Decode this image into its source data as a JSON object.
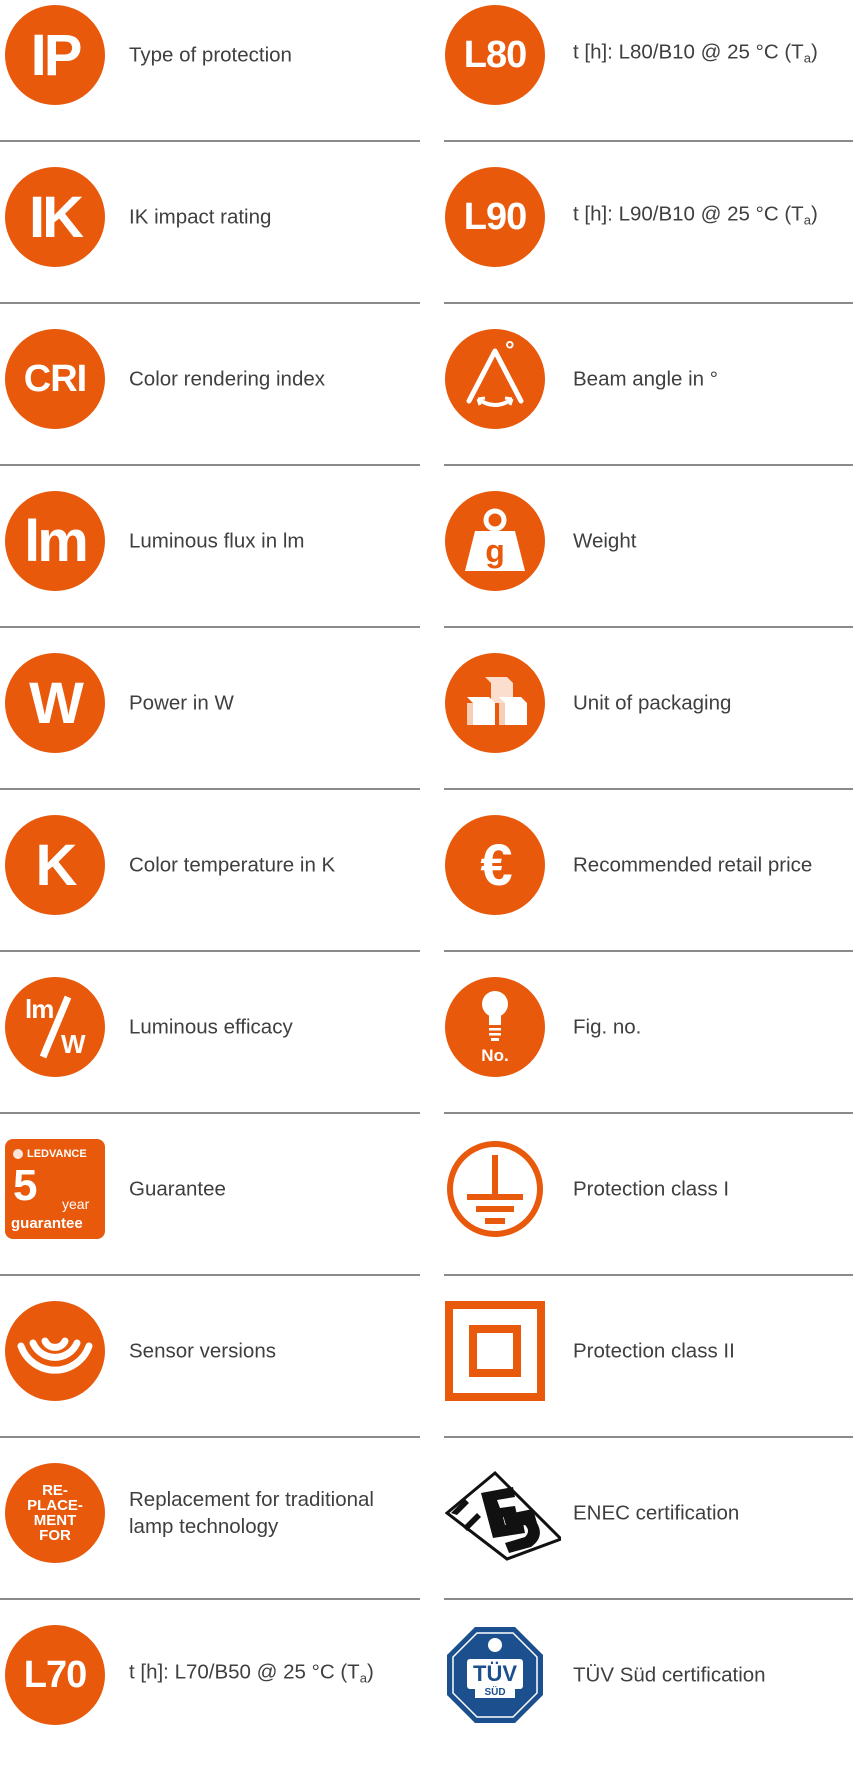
{
  "colors": {
    "accent": "#e8590c",
    "divider": "#8a8a8a",
    "text": "#3f3f3f"
  },
  "left": [
    {
      "icon": "ip-icon",
      "glyph": "IP",
      "label": "Type of protection"
    },
    {
      "icon": "ik-icon",
      "glyph": "IK",
      "label": "IK impact rating"
    },
    {
      "icon": "cri-icon",
      "glyph": "CRI",
      "label": "Color rendering index"
    },
    {
      "icon": "lumen-icon",
      "glyph": "lm",
      "label": "Luminous flux in lm"
    },
    {
      "icon": "watt-icon",
      "glyph": "W",
      "label": "Power in W"
    },
    {
      "icon": "kelvin-icon",
      "glyph": "K",
      "label": "Color temperature in K"
    },
    {
      "icon": "efficacy-icon",
      "glyph_top": "lm",
      "glyph_bottom": "W",
      "label": "Luminous efficacy"
    },
    {
      "icon": "guarantee-badge-icon",
      "brand": "LEDVANCE",
      "number": "5",
      "unit": "year",
      "word": "guarantee",
      "label": "Guarantee"
    },
    {
      "icon": "sensor-icon",
      "label": "Sensor versions"
    },
    {
      "icon": "replacement-icon",
      "lines": [
        "RE-",
        "PLACE-",
        "MENT",
        "FOR"
      ],
      "label": "Replacement for traditional lamp technology"
    },
    {
      "icon": "l70-icon",
      "glyph": "L70",
      "label_pre": "t [h]: L70/B50 @ 25 °C (T",
      "label_sub": "a",
      "label_post": ")"
    }
  ],
  "right": [
    {
      "icon": "l80-icon",
      "glyph": "L80",
      "label_pre": "t [h]: L80/B10 @ 25 °C (T",
      "label_sub": "a",
      "label_post": ")"
    },
    {
      "icon": "l90-icon",
      "glyph": "L90",
      "label_pre": "t [h]: L90/B10 @ 25 °C (T",
      "label_sub": "a",
      "label_post": ")"
    },
    {
      "icon": "beam-angle-icon",
      "glyph": "°",
      "label": "Beam angle in °"
    },
    {
      "icon": "weight-icon",
      "glyph": "g",
      "label": "Weight"
    },
    {
      "icon": "packaging-icon",
      "label": "Unit of packaging"
    },
    {
      "icon": "euro-icon",
      "glyph": "€",
      "label": "Recommended retail price"
    },
    {
      "icon": "fig-no-icon",
      "glyph": "No.",
      "label": "Fig. no."
    },
    {
      "icon": "protection-class-1-icon",
      "label": "Protection class I"
    },
    {
      "icon": "protection-class-2-icon",
      "label": "Protection class II"
    },
    {
      "icon": "enec-icon",
      "label": "ENEC certification"
    },
    {
      "icon": "tuv-sud-icon",
      "badge": "TÜV",
      "badge_sub": "SÜD",
      "label": "TÜV Süd certification"
    }
  ]
}
